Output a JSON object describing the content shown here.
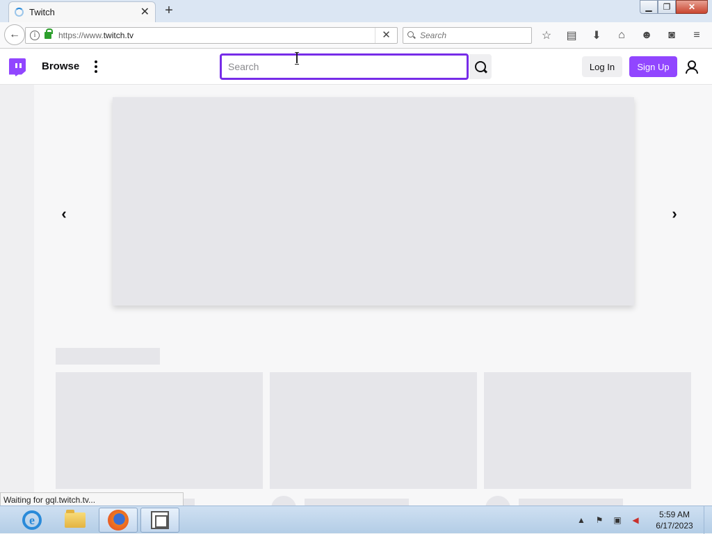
{
  "browser": {
    "tab_title": "Twitch",
    "url_prefix": "https://www.",
    "url_domain": "twitch.tv",
    "search_placeholder": "Search",
    "status_text": "Waiting for gql.twitch.tv..."
  },
  "twitch": {
    "browse_label": "Browse",
    "search_placeholder": "Search",
    "login_label": "Log In",
    "signup_label": "Sign Up",
    "brand_color": "#9146ff"
  },
  "icons": {
    "tab": "loading-spinner-icon",
    "window": [
      "minimize-icon",
      "restore-icon",
      "close-icon"
    ],
    "toolbar": [
      "bookmark-star-icon",
      "reading-list-icon",
      "download-icon",
      "home-icon",
      "hello-icon",
      "pocket-icon",
      "menu-icon"
    ],
    "taskbar": [
      "internet-explorer-icon",
      "file-explorer-icon",
      "firefox-icon",
      "virtualbox-icon"
    ],
    "tray": [
      "tray-expand-icon",
      "flag-icon",
      "network-icon",
      "volume-muted-icon"
    ]
  },
  "taskbar": {
    "time": "5:59 AM",
    "date": "6/17/2023"
  }
}
